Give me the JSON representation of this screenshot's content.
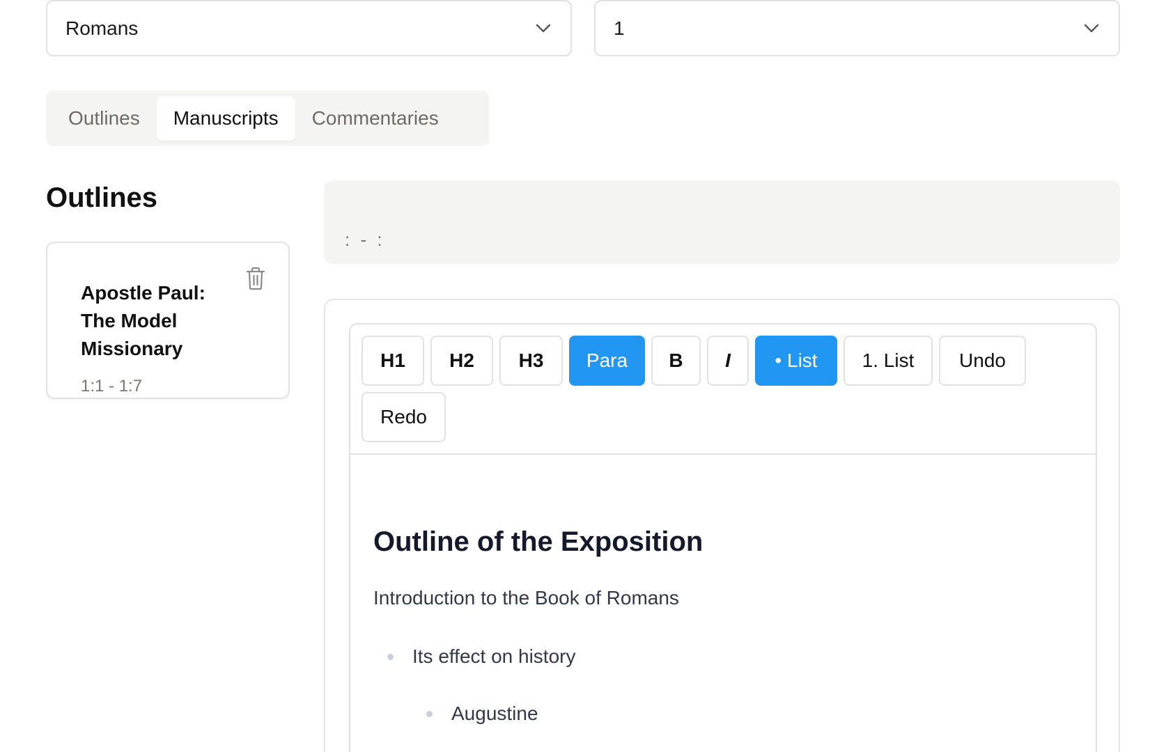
{
  "selects": {
    "book": {
      "value": "Romans",
      "icon": "chevron-down-icon"
    },
    "chapter": {
      "value": "1",
      "icon": "chevron-down-icon"
    }
  },
  "tabs": [
    {
      "label": "Outlines",
      "active": false
    },
    {
      "label": "Manuscripts",
      "active": true
    },
    {
      "label": "Commentaries",
      "active": false
    }
  ],
  "sidebar": {
    "heading": "Outlines",
    "cards": [
      {
        "title": "Apostle Paul: The Model Missionary",
        "range": "1:1 - 1:7",
        "icon": "trash-icon"
      }
    ]
  },
  "reference_bar": {
    "text": ": - :"
  },
  "toolbar": {
    "buttons": [
      {
        "label": "H1",
        "active": false
      },
      {
        "label": "H2",
        "active": false
      },
      {
        "label": "H3",
        "active": false
      },
      {
        "label": "Para",
        "active": true
      },
      {
        "label": "B",
        "active": false
      },
      {
        "label": "I",
        "active": false
      },
      {
        "label": "• List",
        "active": true
      },
      {
        "label": "1. List",
        "active": false
      },
      {
        "label": "Undo",
        "active": false
      },
      {
        "label": "Redo",
        "active": false
      }
    ]
  },
  "document": {
    "heading": "Outline of the Exposition",
    "paragraph": "Introduction to the Book of Romans",
    "list": [
      {
        "text": "Its effect on history",
        "level": 1
      },
      {
        "text": "Augustine",
        "level": 2
      }
    ]
  },
  "colors": {
    "accent": "#2196f3",
    "muted_bg": "#f4f4f3",
    "border": "#e2e2e2"
  }
}
